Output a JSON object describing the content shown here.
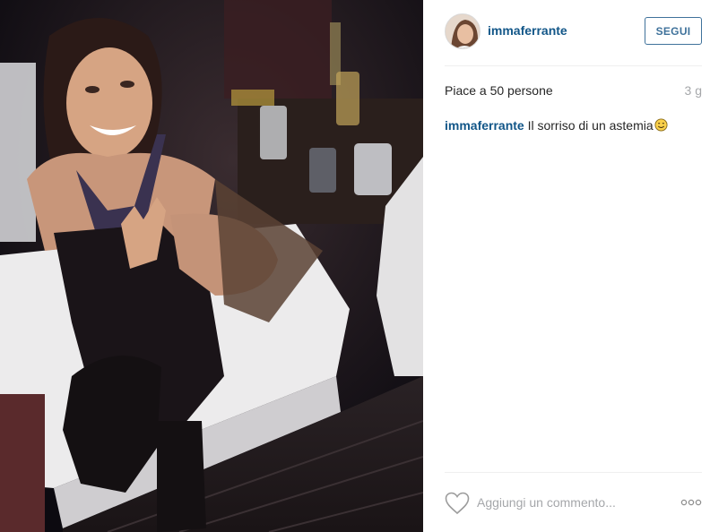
{
  "post": {
    "photo_icon": "photo-of-smiling-woman",
    "header": {
      "avatar_icon": "profile-avatar",
      "username": "immaferrante",
      "follow_label": "SEGUI"
    },
    "likes_text": "Piace a 50 persone",
    "time_ago": "3 g",
    "caption": {
      "username": "immaferrante",
      "text": "Il sorriso di un astemia",
      "emoji_icon": "smiling-face-icon"
    },
    "footer": {
      "like_icon": "heart-icon",
      "comment_placeholder": "Aggiungi un commento...",
      "more_icon": "more-options-icon"
    }
  },
  "colors": {
    "link_blue": "#125688",
    "button_blue": "#3f729b",
    "muted_gray": "#a5a7aa",
    "divider": "#efefef"
  }
}
